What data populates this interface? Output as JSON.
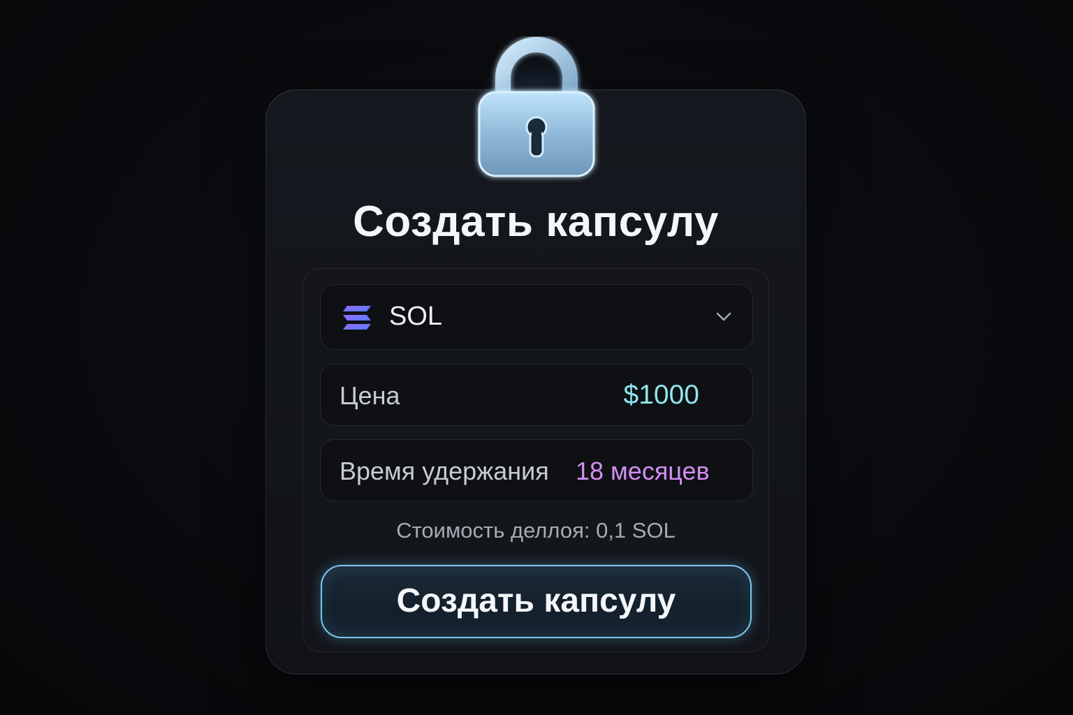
{
  "title": "Создать капсулу",
  "token_select": {
    "selected": "SOL",
    "icon": "solana-icon"
  },
  "price": {
    "label": "Цена",
    "value": "$1000"
  },
  "hold": {
    "label": "Время удержания",
    "value": "18 месяцев"
  },
  "fee_text": "Стоимость деллоя: 0,1 SOL",
  "cta_label": "Создать капсулу",
  "icons": [
    "lock-icon",
    "solana-icon",
    "chevron-down-icon"
  ],
  "colors": {
    "price_value": "#8fe6ee",
    "hold_value": "#d48ef2",
    "button_border": "#7ec8ec",
    "lock_glow": "#a9d8ff"
  }
}
